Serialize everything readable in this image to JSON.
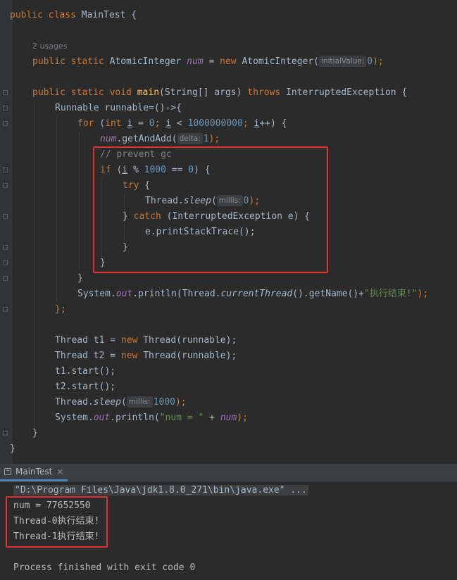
{
  "editor": {
    "usages": "2 usages",
    "code": {
      "l1": {
        "kw1": "public class ",
        "name": "MainTest {"
      },
      "l4": {
        "kw1": "public static ",
        "type": "AtomicInteger ",
        "field": "num",
        "eq": " = ",
        "kw2": "new ",
        "ctor": "AtomicInteger(",
        "hint": "initialValue:",
        "arg": "0",
        "end": ");"
      },
      "l6": {
        "kw1": "public static void ",
        "fn": "main",
        "params": "(String[] args) ",
        "kw2": "throws ",
        "rest": "InterruptedException {"
      },
      "l7": {
        "text": "Runnable runnable=()->{"
      },
      "l8": {
        "kw": "for",
        "p1": " (",
        "kw2": "int ",
        "v1": "i",
        "p2": " = ",
        "n1": "0",
        "semi1": "; ",
        "v2": "i",
        "p3": " < ",
        "n2": "1000000000",
        "semi2": "; ",
        "v3": "i",
        "p4": "++) {"
      },
      "l9": {
        "field": "num",
        "call": ".getAndAdd(",
        "hint": "delta:",
        "arg": "1",
        "end": ");"
      },
      "l10": {
        "comment": "// prevent gc"
      },
      "l11": {
        "kw": "if",
        "p1": " (",
        "v": "i",
        "p2": " % ",
        "n1": "1000",
        "p3": " == ",
        "n2": "0",
        "p4": ") {"
      },
      "l12": {
        "kw": "try",
        "p": " {"
      },
      "l13": {
        "cls": "Thread.",
        "method": "sleep",
        "p": "(",
        "hint": "millis:",
        "arg": "0",
        "end": ");"
      },
      "l14": {
        "p1": "} ",
        "kw": "catch",
        "p2": " (InterruptedException e) {"
      },
      "l15": {
        "text": "e.printStackTrace();"
      },
      "l16": {
        "text": "}"
      },
      "l17": {
        "text": "}"
      },
      "l18": {
        "text": "}"
      },
      "l19": {
        "a": "System.",
        "field": "out",
        "b": ".println(Thread.",
        "method": "currentThread",
        "c": "().getName()+",
        "str": "\"执行结束!\"",
        "end": ");"
      },
      "l20": {
        "text": "};"
      },
      "l22": {
        "a": "Thread t1 = ",
        "kw": "new ",
        "b": "Thread(runnable);"
      },
      "l23": {
        "a": "Thread t2 = ",
        "kw": "new ",
        "b": "Thread(runnable);"
      },
      "l24": {
        "text": "t1.start();"
      },
      "l25": {
        "text": "t2.start();"
      },
      "l26": {
        "cls": "Thread.",
        "method": "sleep",
        "p": "(",
        "hint": "millis:",
        "arg": "1000",
        "end": ");"
      },
      "l27": {
        "a": "System.",
        "field": "out",
        "b": ".println(",
        "str": "\"num = \"",
        "c": " + ",
        "field2": "num",
        "end": ");"
      },
      "l28": {
        "text": "}"
      },
      "l29": {
        "text": "}"
      }
    }
  },
  "console": {
    "tab_label": "MainTest",
    "tab_close": "×",
    "command": "\"D:\\Program Files\\Java\\jdk1.8.0_271\\bin\\java.exe\" ...",
    "output": [
      "num = 77652550",
      "Thread-0执行结束!",
      "Thread-1执行结束!"
    ],
    "exit_message": "Process finished with exit code 0"
  },
  "colors": {
    "background": "#2b2b2b",
    "keyword": "#cc7832",
    "function": "#ffc66d",
    "number": "#6897bb",
    "string": "#6a8759",
    "field": "#9876aa",
    "highlight_box": "#e03131"
  }
}
